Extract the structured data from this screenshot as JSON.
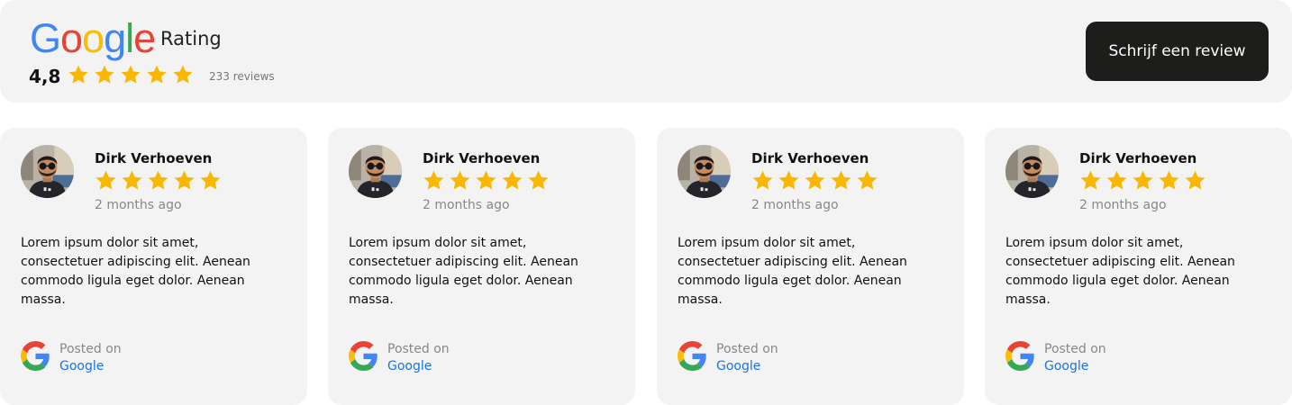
{
  "header": {
    "logo": {
      "letters": [
        "G",
        "o",
        "o",
        "g",
        "l",
        "e"
      ]
    },
    "title": "Rating",
    "score": "4,8",
    "stars": 5,
    "review_count": "233 reviews",
    "write_button": "Schrijf een review"
  },
  "colors": {
    "star": "#f9b700",
    "google_blue": "#4285F4",
    "google_red": "#EA4335",
    "google_yellow": "#FBBC05",
    "google_green": "#34A853",
    "link_blue": "#1a73e8",
    "button_bg": "#1d1e1b"
  },
  "reviews": [
    {
      "name": "Dirk Verhoeven",
      "stars": 5,
      "time": "2 months ago",
      "text": "Lorem ipsum dolor sit amet, consectetuer adipiscing elit. Aenean commodo ligula eget dolor. Aenean massa.",
      "posted_label": "Posted on",
      "platform": "Google"
    },
    {
      "name": "Dirk Verhoeven",
      "stars": 5,
      "time": "2 months ago",
      "text": "Lorem ipsum dolor sit amet, consectetuer adipiscing elit. Aenean commodo ligula eget dolor. Aenean massa.",
      "posted_label": "Posted on",
      "platform": "Google"
    },
    {
      "name": "Dirk Verhoeven",
      "stars": 5,
      "time": "2 months ago",
      "text": "Lorem ipsum dolor sit amet, consectetuer adipiscing elit. Aenean commodo ligula eget dolor. Aenean massa.",
      "posted_label": "Posted on",
      "platform": "Google"
    },
    {
      "name": "Dirk Verhoeven",
      "stars": 5,
      "time": "2 months ago",
      "text": "Lorem ipsum dolor sit amet, consectetuer adipiscing elit. Aenean commodo ligula eget dolor. Aenean massa.",
      "posted_label": "Posted on",
      "platform": "Google"
    }
  ]
}
